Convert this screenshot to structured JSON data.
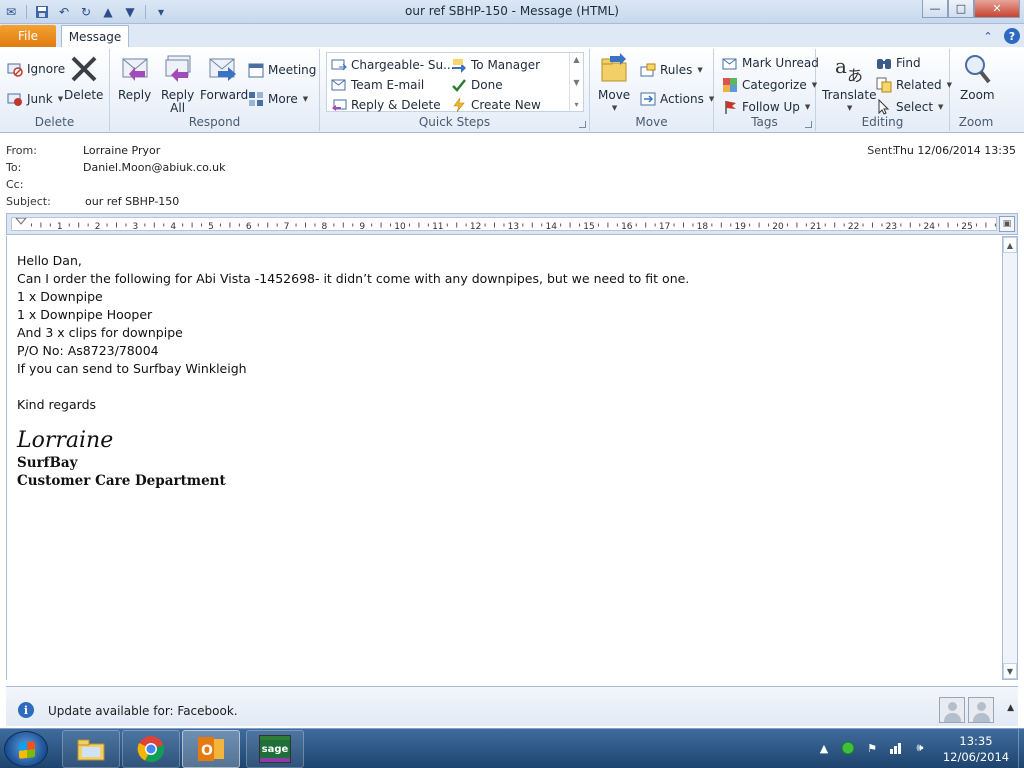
{
  "window": {
    "title": "our ref SBHP-150  -  Message (HTML)",
    "min": "—",
    "max": "□",
    "close": "✕"
  },
  "tabs": {
    "file": "File",
    "message": "Message"
  },
  "ribbon": {
    "delete_group": {
      "label": "Delete",
      "ignore": "Ignore",
      "junk": "Junk",
      "delete": "Delete"
    },
    "respond_group": {
      "label": "Respond",
      "reply": "Reply",
      "reply_all_1": "Reply",
      "reply_all_2": "All",
      "forward": "Forward",
      "meeting": "Meeting",
      "more": "More"
    },
    "quick_steps_group": {
      "label": "Quick Steps",
      "items": [
        "Chargeable- Su...",
        "To Manager",
        "Team E-mail",
        "Done",
        "Reply & Delete",
        "Create New"
      ]
    },
    "move_group": {
      "label": "Move",
      "move": "Move",
      "rules": "Rules",
      "actions": "Actions"
    },
    "tags_group": {
      "label": "Tags",
      "mark_unread": "Mark Unread",
      "categorize": "Categorize",
      "follow_up": "Follow Up"
    },
    "editing_group": {
      "label": "Editing",
      "translate": "Translate",
      "find": "Find",
      "related": "Related",
      "select": "Select"
    },
    "zoom_group": {
      "label": "Zoom",
      "zoom": "Zoom"
    }
  },
  "header": {
    "from_label": "From:",
    "from": "Lorraine Pryor",
    "to_label": "To:",
    "to": "Daniel.Moon@abiuk.co.uk",
    "cc_label": "Cc:",
    "cc": "",
    "subject_label": "Subject:",
    "subject": "our ref SBHP-150",
    "sent_label": "Sent:",
    "sent": "Thu 12/06/2014 13:35"
  },
  "ruler": {
    "numbers": [
      "1",
      "2",
      "3",
      "4",
      "5",
      "6",
      "7",
      "8",
      "9",
      "10",
      "11",
      "12",
      "13",
      "14",
      "15",
      "16",
      "17",
      "18",
      "19",
      "20",
      "21",
      "22",
      "23",
      "24",
      "25"
    ]
  },
  "body": {
    "lines": [
      "Hello Dan,",
      "Can I order the following for Abi Vista -1452698- it didn’t come with any downpipes, but we need to fit one.",
      "1 x Downpipe",
      "1 x Downpipe Hooper",
      "And 3 x clips for downpipe",
      "P/O No: As8723/78004",
      "If you can send to Surfbay Winkleigh",
      "",
      "Kind regards"
    ],
    "signature_name": "Lorraine",
    "signature_company": "SurfBay",
    "signature_dept": "Customer Care Department"
  },
  "infobar": {
    "text": "Update available for: Facebook."
  },
  "taskbar": {
    "time": "13:35",
    "date": "12/06/2014",
    "sage_label": "sage"
  }
}
